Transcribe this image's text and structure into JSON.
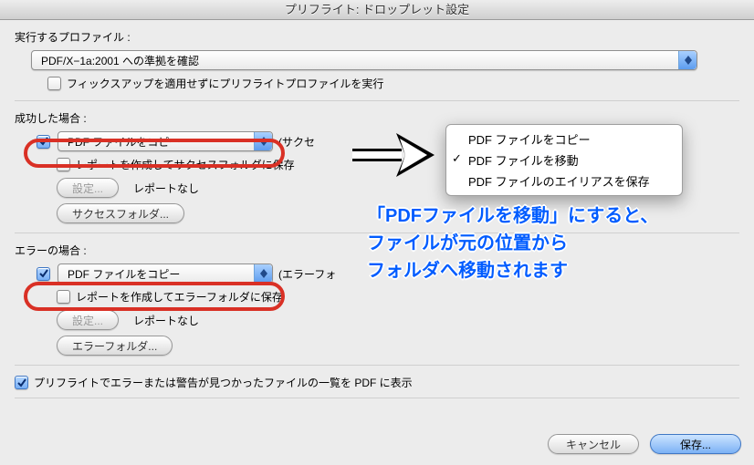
{
  "window": {
    "title": "プリフライト: ドロップレット設定"
  },
  "profile": {
    "label": "実行するプロファイル :",
    "value": "PDF/X−1a:2001 への準拠を確認",
    "fixup_label": "フィックスアップを適用せずにプリフライトプロファイルを実行"
  },
  "success": {
    "label": "成功した場合 :",
    "action_select": "PDF ファイルをコピー",
    "suffix": "(サクセ",
    "report_label": "レポートを作成してサクセスフォルダに保存",
    "settings_btn": "設定...",
    "report_status": "レポートなし",
    "folder_btn": "サクセスフォルダ..."
  },
  "error": {
    "label": "エラーの場合 :",
    "action_select": "PDF ファイルをコピー",
    "suffix": "(エラーフォ",
    "report_label": "レポートを作成してエラーフォルダに保存",
    "settings_btn": "設定...",
    "report_status": "レポートなし",
    "folder_btn": "エラーフォルダ..."
  },
  "summary_check": "プリフライトでエラーまたは警告が見つかったファイルの一覧を PDF に表示",
  "footer": {
    "cancel": "キャンセル",
    "save": "保存..."
  },
  "popup_menu": {
    "items": [
      {
        "label": "PDF ファイルをコピー",
        "checked": false
      },
      {
        "label": "PDF ファイルを移動",
        "checked": true
      },
      {
        "label": "PDF ファイルのエイリアスを保存",
        "checked": false
      }
    ]
  },
  "annotation": {
    "line1": "「PDFファイルを移動」にすると、",
    "line2": "ファイルが元の位置から",
    "line3": "フォルダへ移動されます"
  }
}
